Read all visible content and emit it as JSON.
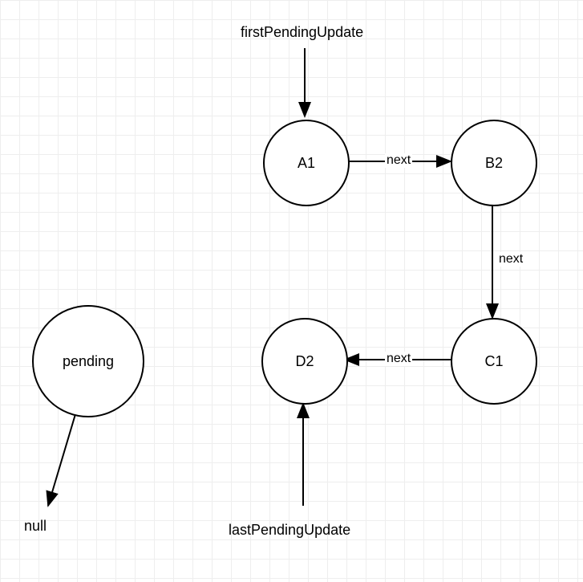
{
  "labels": {
    "firstPendingUpdate": "firstPendingUpdate",
    "lastPendingUpdate": "lastPendingUpdate",
    "null": "null"
  },
  "nodes": {
    "a1": "A1",
    "b2": "B2",
    "c1": "C1",
    "d2": "D2",
    "pending": "pending"
  },
  "edges": {
    "a1_b2": "next",
    "b2_c1": "next",
    "c1_d2": "next"
  }
}
